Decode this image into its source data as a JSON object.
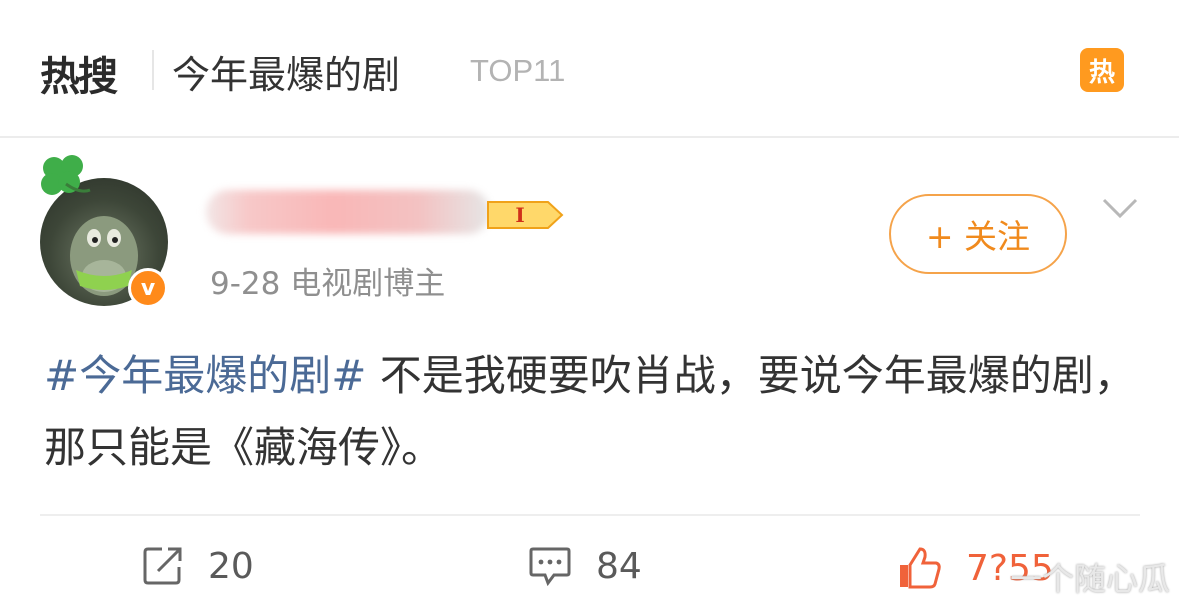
{
  "hot_search": {
    "logo_text": "热搜",
    "topic": "今年最爆的剧",
    "rank": "TOP11",
    "badge": "热"
  },
  "post": {
    "meta": "9-28  电视剧博主",
    "verified_badge": "v",
    "level_badge": "I",
    "hashtag": "#今年最爆的剧#",
    "body": " 不是我硬要吹肖战，要说今年最爆的剧，那只能是《藏海传》。",
    "follow_label": "+ 关注"
  },
  "actions": {
    "repost_count": "20",
    "comment_count": "84",
    "like_count": "7?55"
  },
  "watermark": "一个随心瓜",
  "colors": {
    "accent_orange": "#ff8200",
    "hashtag_blue": "#4b6a96",
    "like_red": "#f0623a"
  },
  "icons": [
    "clover-icon",
    "chevron-down-icon",
    "repost-icon",
    "comment-icon",
    "like-icon"
  ]
}
